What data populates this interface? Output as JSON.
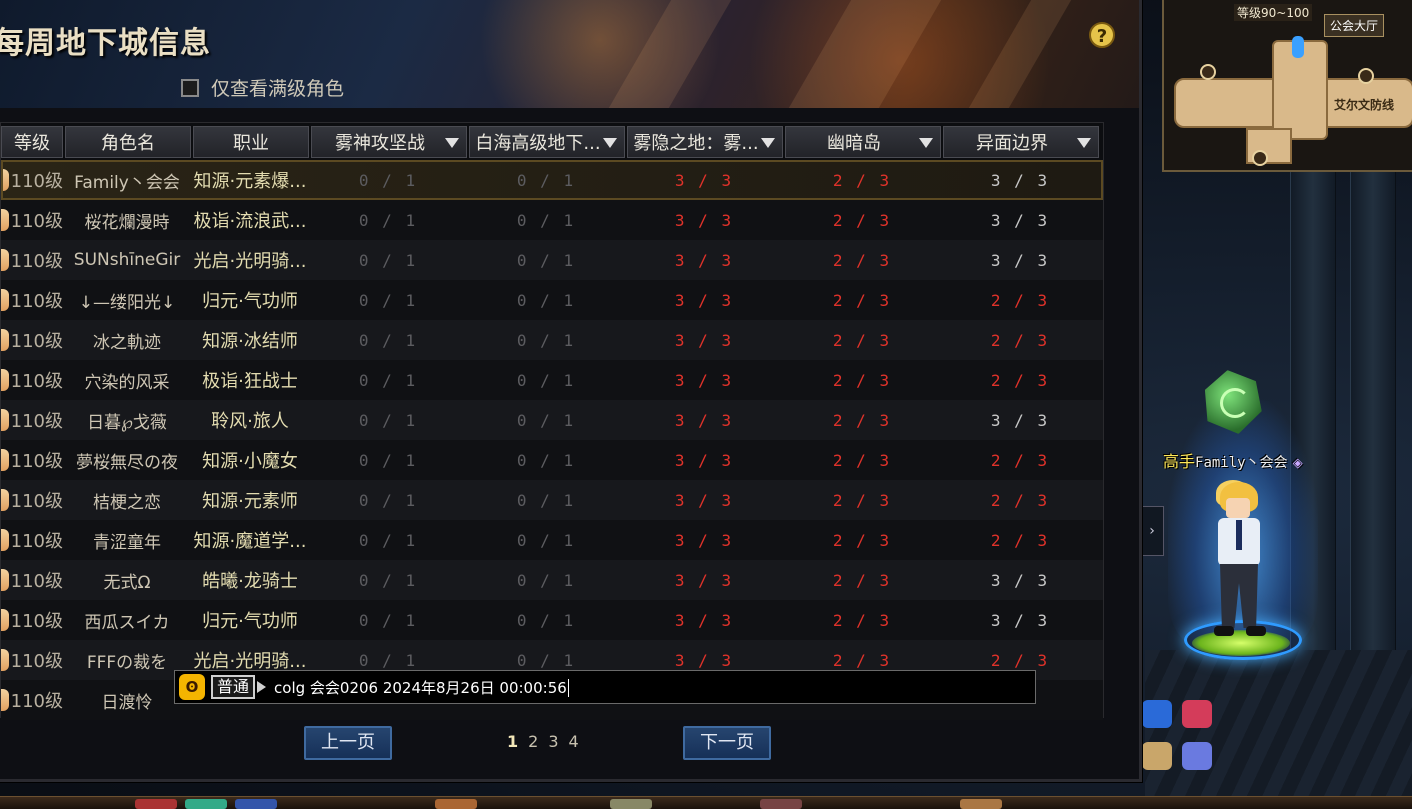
{
  "window": {
    "title": "每周地下城信息",
    "help_label": "?",
    "filter_label": "仅查看满级角色"
  },
  "table": {
    "headers": [
      "等级",
      "角色名",
      "职业",
      "雾神攻坚战",
      "白海高级地下...",
      "雾隐之地：雾...",
      "幽暗岛",
      "异面边界"
    ],
    "rows": [
      {
        "level": "110级",
        "name": "Family丶会会",
        "job": "知源·元素爆...",
        "d1": "0 / 1",
        "d2": "0 / 1",
        "d3": "3 / 3",
        "d4": "2 / 3",
        "d5": "3 / 3",
        "d5_done": false
      },
      {
        "level": "110级",
        "name": "桜花爛漫時",
        "job": "极诣·流浪武...",
        "d1": "0 / 1",
        "d2": "0 / 1",
        "d3": "3 / 3",
        "d4": "2 / 3",
        "d5": "3 / 3",
        "d5_done": false
      },
      {
        "level": "110级",
        "name": "SUNshīneGir",
        "job": "光启·光明骑...",
        "d1": "0 / 1",
        "d2": "0 / 1",
        "d3": "3 / 3",
        "d4": "2 / 3",
        "d5": "3 / 3",
        "d5_done": false
      },
      {
        "level": "110级",
        "name": "↓—缕阳光↓",
        "job": "归元·气功师",
        "d1": "0 / 1",
        "d2": "0 / 1",
        "d3": "3 / 3",
        "d4": "2 / 3",
        "d5": "2 / 3",
        "d5_done": true
      },
      {
        "level": "110级",
        "name": "冰之軌迹",
        "job": "知源·冰结师",
        "d1": "0 / 1",
        "d2": "0 / 1",
        "d3": "3 / 3",
        "d4": "2 / 3",
        "d5": "2 / 3",
        "d5_done": true
      },
      {
        "level": "110级",
        "name": "穴染的风采",
        "job": "极诣·狂战士",
        "d1": "0 / 1",
        "d2": "0 / 1",
        "d3": "3 / 3",
        "d4": "2 / 3",
        "d5": "2 / 3",
        "d5_done": true
      },
      {
        "level": "110级",
        "name": "日暮℘戈薇",
        "job": "聆风·旅人",
        "d1": "0 / 1",
        "d2": "0 / 1",
        "d3": "3 / 3",
        "d4": "2 / 3",
        "d5": "3 / 3",
        "d5_done": false
      },
      {
        "level": "110级",
        "name": "夢桜無尽の夜",
        "job": "知源·小魔女",
        "d1": "0 / 1",
        "d2": "0 / 1",
        "d3": "3 / 3",
        "d4": "2 / 3",
        "d5": "2 / 3",
        "d5_done": true
      },
      {
        "level": "110级",
        "name": "桔梗之恋",
        "job": "知源·元素师",
        "d1": "0 / 1",
        "d2": "0 / 1",
        "d3": "3 / 3",
        "d4": "2 / 3",
        "d5": "2 / 3",
        "d5_done": true
      },
      {
        "level": "110级",
        "name": "青涩童年",
        "job": "知源·魔道学...",
        "d1": "0 / 1",
        "d2": "0 / 1",
        "d3": "3 / 3",
        "d4": "2 / 3",
        "d5": "2 / 3",
        "d5_done": true
      },
      {
        "level": "110级",
        "name": "无式Ω",
        "job": "皓曦·龙骑士",
        "d1": "0 / 1",
        "d2": "0 / 1",
        "d3": "3 / 3",
        "d4": "2 / 3",
        "d5": "3 / 3",
        "d5_done": false
      },
      {
        "level": "110级",
        "name": "西瓜スイカ",
        "job": "归元·气功师",
        "d1": "0 / 1",
        "d2": "0 / 1",
        "d3": "3 / 3",
        "d4": "2 / 3",
        "d5": "3 / 3",
        "d5_done": false
      },
      {
        "level": "110级",
        "name": "FFFの裁を",
        "job": "光启·光明骑...",
        "d1": "0 / 1",
        "d2": "0 / 1",
        "d3": "3 / 3",
        "d4": "2 / 3",
        "d5": "2 / 3",
        "d5_done": true
      },
      {
        "level": "110级",
        "name": "日渡怜",
        "job": "",
        "d1": "",
        "d2": "",
        "d3": "",
        "d4": "",
        "d5": "",
        "d5_done": false
      }
    ]
  },
  "pager": {
    "prev_label": "上一页",
    "next_label": "下一页",
    "pages": [
      "1",
      "2",
      "3",
      "4"
    ],
    "current_page": "1"
  },
  "chat": {
    "channel": "普通",
    "text": "colg 会会0206 2024年8月26日 00:00:56"
  },
  "minimap": {
    "level_range": "等级90~100",
    "hall_label": "公会大厅",
    "fort_label": "艾尔文防线"
  },
  "player": {
    "rank": "高手",
    "name": "Family丶会会"
  },
  "colors": {
    "done_red": "#e0322a",
    "pending_gray": "#5c5c60",
    "header_text": "#eadfc4"
  }
}
